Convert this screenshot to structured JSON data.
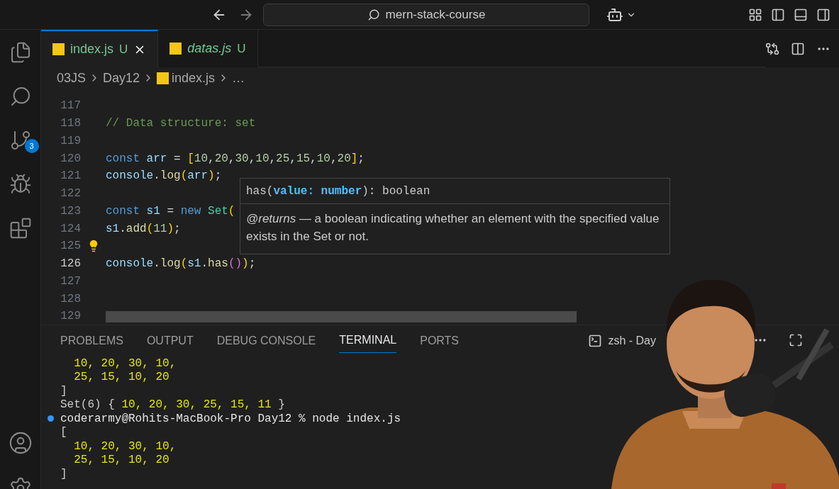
{
  "title_bar": {
    "search": "mern-stack-course"
  },
  "activity_bar": {
    "source_control_badge": "3"
  },
  "tabs": [
    {
      "label": "index.js",
      "status": "U",
      "selected": true,
      "italic": false
    },
    {
      "label": "datas.js",
      "status": "U",
      "selected": false,
      "italic": true
    }
  ],
  "breadcrumb": [
    "03JS",
    "Day12",
    "index.js",
    "…"
  ],
  "editor": {
    "lines": [
      {
        "number": "117",
        "current": false
      },
      {
        "number": "118",
        "current": false,
        "tokens": [
          {
            "text": "// Data structure: set",
            "kind": "comment"
          }
        ]
      },
      {
        "number": "119",
        "current": false
      },
      {
        "number": "120",
        "current": false,
        "tokens": [
          {
            "text": "const",
            "kind": "keyword"
          },
          {
            "text": " arr",
            "kind": "variable"
          },
          {
            "text": " = ",
            "kind": "plain"
          },
          {
            "text": "[",
            "kind": "bracket"
          },
          {
            "text": "10",
            "kind": "number"
          },
          {
            "text": ",",
            "kind": "plain"
          },
          {
            "text": "20",
            "kind": "number"
          },
          {
            "text": ",",
            "kind": "plain"
          },
          {
            "text": "30",
            "kind": "number"
          },
          {
            "text": ",",
            "kind": "plain"
          },
          {
            "text": "10",
            "kind": "number"
          },
          {
            "text": ",",
            "kind": "plain"
          },
          {
            "text": "25",
            "kind": "number"
          },
          {
            "text": ",",
            "kind": "plain"
          },
          {
            "text": "15",
            "kind": "number"
          },
          {
            "text": ",",
            "kind": "plain"
          },
          {
            "text": "10",
            "kind": "number"
          },
          {
            "text": ",",
            "kind": "plain"
          },
          {
            "text": "20",
            "kind": "number"
          },
          {
            "text": "]",
            "kind": "bracket"
          },
          {
            "text": ";",
            "kind": "plain"
          }
        ]
      },
      {
        "number": "121",
        "current": false,
        "tokens": [
          {
            "text": "console",
            "kind": "variable"
          },
          {
            "text": ".",
            "kind": "plain"
          },
          {
            "text": "log",
            "kind": "function"
          },
          {
            "text": "(",
            "kind": "bracket"
          },
          {
            "text": "arr",
            "kind": "variable"
          },
          {
            "text": ")",
            "kind": "bracket"
          },
          {
            "text": ";",
            "kind": "plain"
          }
        ]
      },
      {
        "number": "122",
        "current": false
      },
      {
        "number": "123",
        "current": false,
        "tokens": [
          {
            "text": "const",
            "kind": "keyword"
          },
          {
            "text": " s1",
            "kind": "variable"
          },
          {
            "text": " = ",
            "kind": "plain"
          },
          {
            "text": "new",
            "kind": "keyword"
          },
          {
            "text": " Set",
            "kind": "class"
          },
          {
            "text": "(",
            "kind": "bracket"
          }
        ]
      },
      {
        "number": "124",
        "current": false,
        "tokens": [
          {
            "text": "s1",
            "kind": "variable"
          },
          {
            "text": ".",
            "kind": "plain"
          },
          {
            "text": "add",
            "kind": "function"
          },
          {
            "text": "(",
            "kind": "bracket"
          },
          {
            "text": "11",
            "kind": "number"
          },
          {
            "text": ")",
            "kind": "bracket"
          },
          {
            "text": ";",
            "kind": "plain"
          }
        ]
      },
      {
        "number": "125",
        "current": false,
        "lightbulb": true
      },
      {
        "number": "126",
        "current": true,
        "tokens": [
          {
            "text": "console",
            "kind": "variable"
          },
          {
            "text": ".",
            "kind": "plain"
          },
          {
            "text": "log",
            "kind": "function"
          },
          {
            "text": "(",
            "kind": "bracket"
          },
          {
            "text": "s1",
            "kind": "variable"
          },
          {
            "text": ".",
            "kind": "plain"
          },
          {
            "text": "has",
            "kind": "function"
          },
          {
            "text": "()",
            "kind": "bracket2"
          },
          {
            "text": ")",
            "kind": "bracket"
          },
          {
            "text": ";",
            "kind": "plain"
          }
        ]
      },
      {
        "number": "127",
        "current": false
      },
      {
        "number": "128",
        "current": false
      },
      {
        "number": "129",
        "current": false
      }
    ]
  },
  "hover": {
    "signature": "has(**value: number**): boolean",
    "doc": "*@returns* — a boolean indicating whether an element with the specified value exists in the Set or not."
  },
  "panel": {
    "tabs": [
      {
        "label": "PROBLEMS",
        "selected": false
      },
      {
        "label": "OUTPUT",
        "selected": false
      },
      {
        "label": "DEBUG CONSOLE",
        "selected": false
      },
      {
        "label": "TERMINAL",
        "selected": true
      },
      {
        "label": "PORTS",
        "selected": false
      }
    ],
    "terminal_name": "zsh - Day",
    "lines": [
      {
        "kind": "numbers",
        "text": "  10, 20, 30, 10,"
      },
      {
        "kind": "numbers",
        "text": "  25, 15, 10, 20"
      },
      {
        "kind": "plain",
        "text": "]"
      },
      {
        "kind": "set",
        "prefix": "Set(6) { ",
        "text": "10, 20, 30, 25, 15, 11",
        "suffix": " }"
      },
      {
        "kind": "prompt",
        "text": "coderarmy@Rohits-MacBook-Pro Day12 % node index.js"
      },
      {
        "kind": "plain",
        "text": "["
      },
      {
        "kind": "numbers",
        "text": "  10, 20, 30, 10,"
      },
      {
        "kind": "numbers",
        "text": "  25, 15, 10, 20"
      },
      {
        "kind": "plain",
        "text": "]"
      }
    ]
  }
}
